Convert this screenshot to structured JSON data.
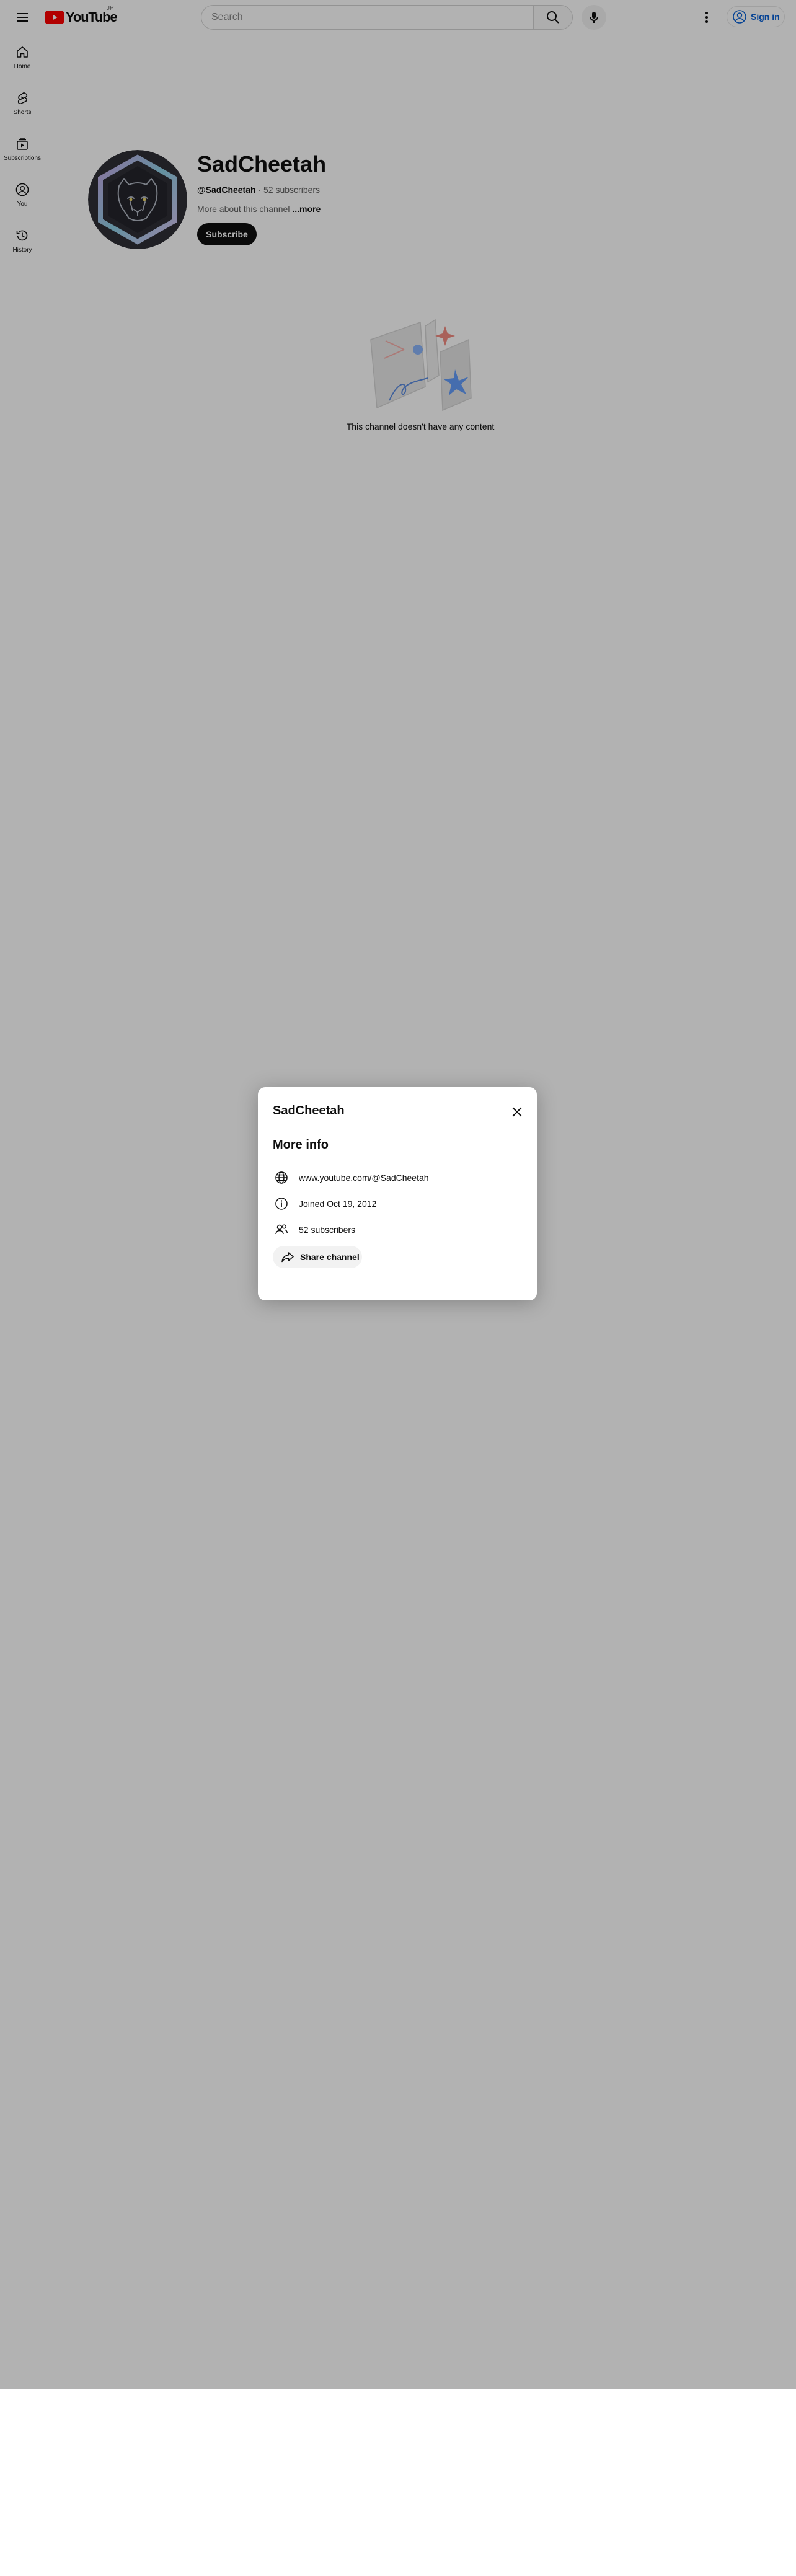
{
  "app": {
    "logo_text": "YouTube",
    "country_code": "JP"
  },
  "topbar": {
    "search_placeholder": "Search",
    "sign_in_label": "Sign in"
  },
  "sidebar": {
    "items": [
      {
        "label": "Home",
        "icon": "home-icon"
      },
      {
        "label": "Shorts",
        "icon": "shorts-icon"
      },
      {
        "label": "Subscriptions",
        "icon": "subscriptions-icon"
      },
      {
        "label": "You",
        "icon": "you-icon"
      },
      {
        "label": "History",
        "icon": "history-icon"
      }
    ]
  },
  "channel": {
    "name": "SadCheetah",
    "handle": "@SadCheetah",
    "separator": " · ",
    "subscribers": "52 subscribers",
    "description": "More about this channel",
    "more_label": " ...more",
    "subscribe_label": "Subscribe",
    "empty_message": "This channel doesn't have any content"
  },
  "dialog": {
    "title": "SadCheetah",
    "section_title": "More info",
    "rows": [
      {
        "icon": "globe-icon",
        "text": "www.youtube.com/@SadCheetah"
      },
      {
        "icon": "info-icon",
        "text": "Joined Oct 19, 2012"
      },
      {
        "icon": "people-icon",
        "text": "52 subscribers"
      }
    ],
    "share_label": "Share channel"
  },
  "colors": {
    "brand_red": "#ff0000",
    "link_blue": "#065fd4",
    "text_primary": "#0f0f0f",
    "text_secondary": "#606060",
    "scrim": "rgba(0,0,0,0.30)"
  }
}
